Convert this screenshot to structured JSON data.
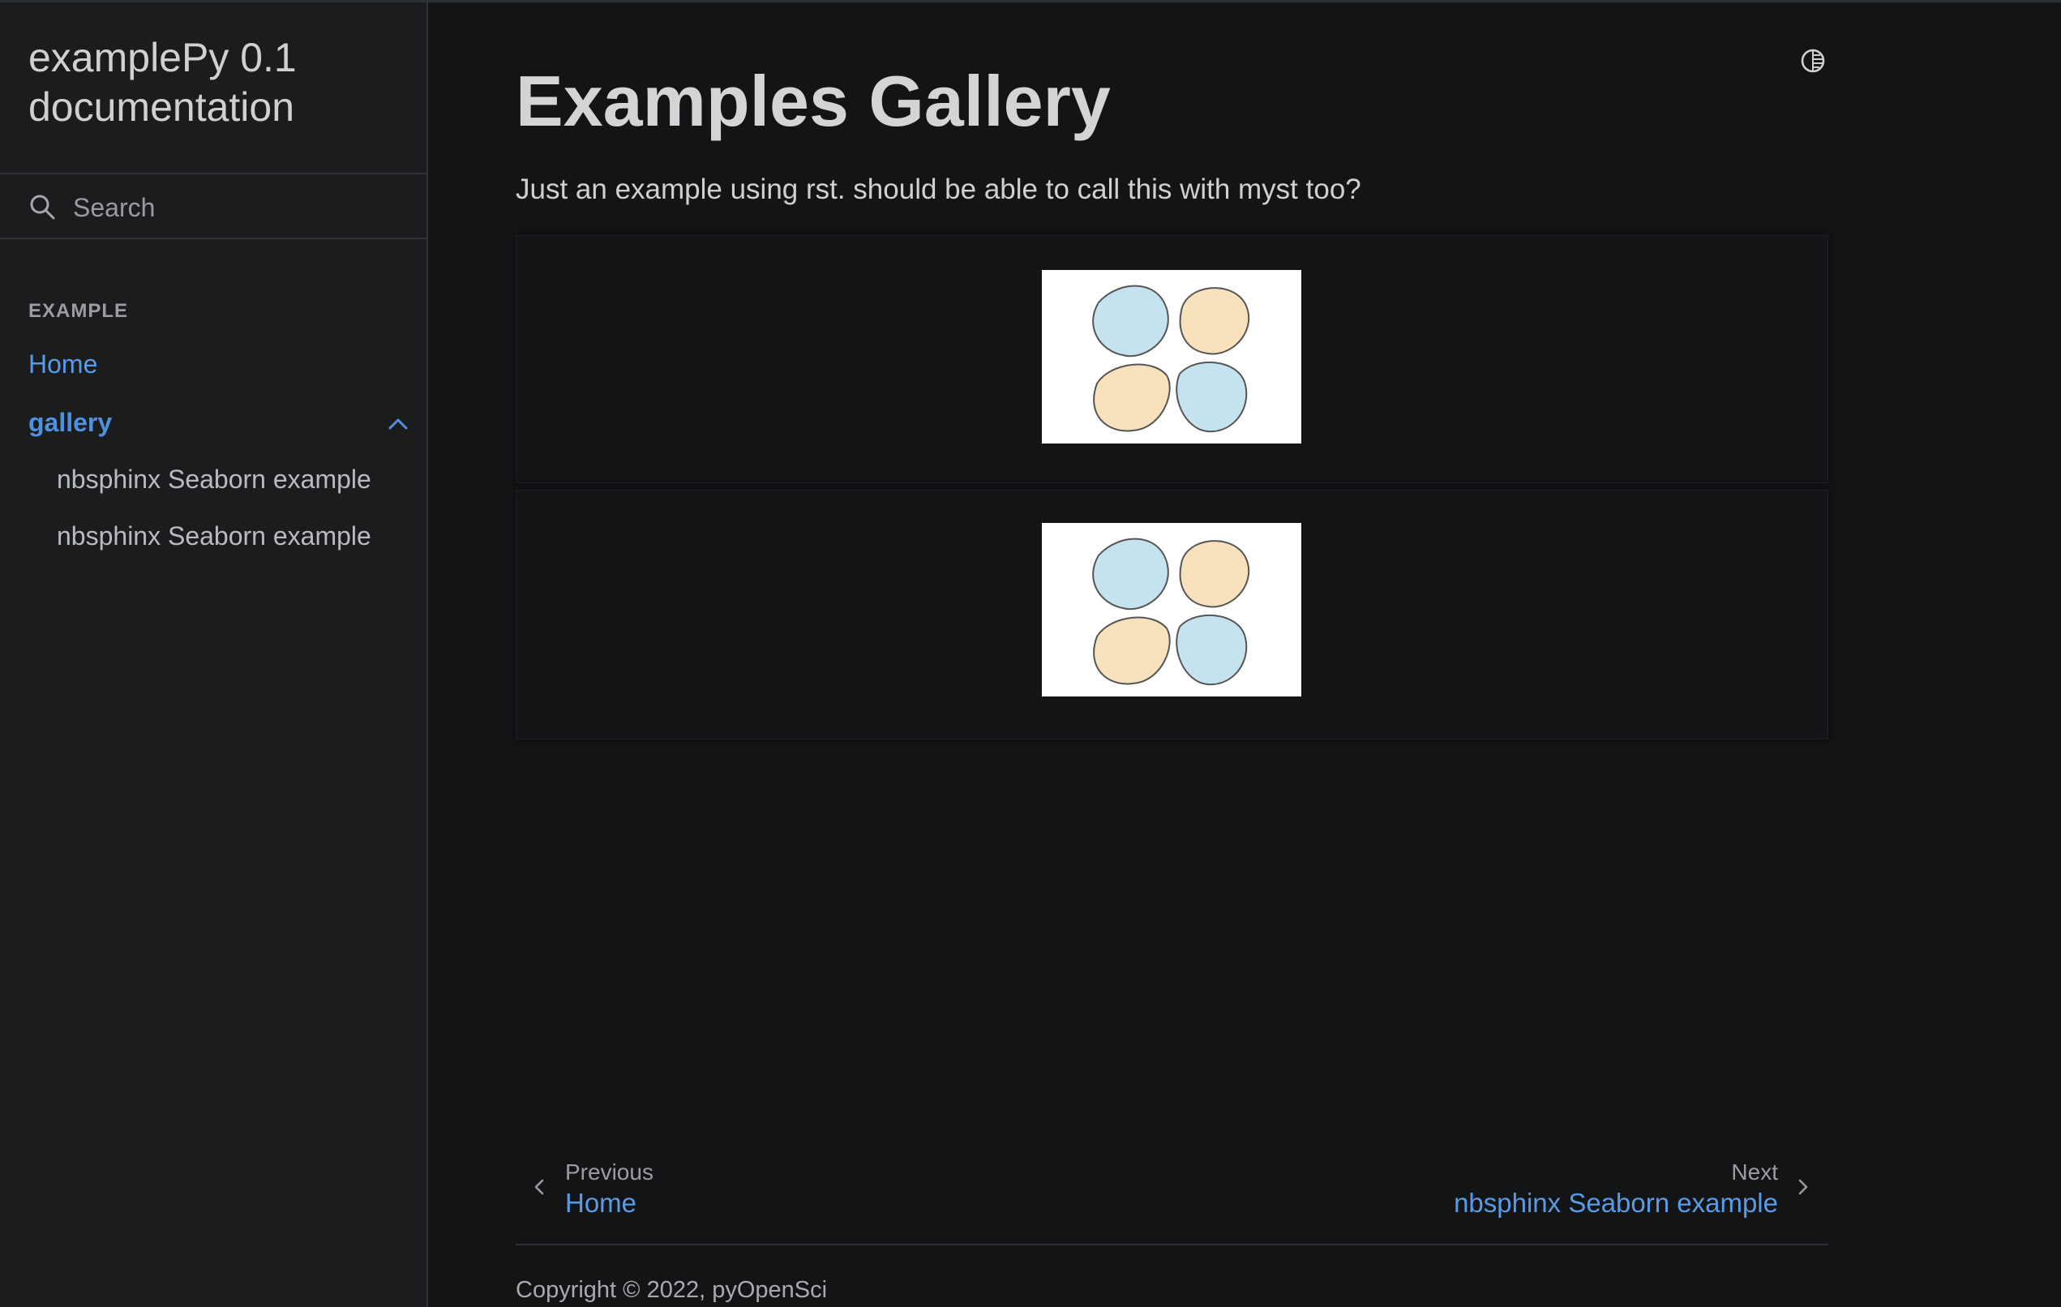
{
  "sidebar": {
    "brand": "examplePy 0.1 documentation",
    "search": {
      "placeholder": "Search",
      "value": ""
    },
    "caption": "EXAMPLE",
    "items": [
      {
        "label": "Home"
      },
      {
        "label": "gallery",
        "expanded": true,
        "children": [
          {
            "label": "nbsphinx Seaborn example"
          },
          {
            "label": "nbsphinx Seaborn example"
          }
        ]
      }
    ]
  },
  "main": {
    "title": "Examples Gallery",
    "intro": "Just an example using rst. should be able to call this with myst too?",
    "gallery": [
      {
        "thumbnail": "four-lobed-blob-image"
      },
      {
        "thumbnail": "four-lobed-blob-image"
      }
    ]
  },
  "footer": {
    "prev": {
      "caption": "Previous",
      "label": "Home"
    },
    "next": {
      "caption": "Next",
      "label": "nbsphinx Seaborn example"
    },
    "copyright": "Copyright © 2022, pyOpenSci"
  },
  "colors": {
    "background": "#131416",
    "sidebar_bg": "#1a1c1e",
    "link": "#5a9be6",
    "lobe_blue": "#c4e3ee",
    "lobe_tan": "#f7e1bd"
  }
}
